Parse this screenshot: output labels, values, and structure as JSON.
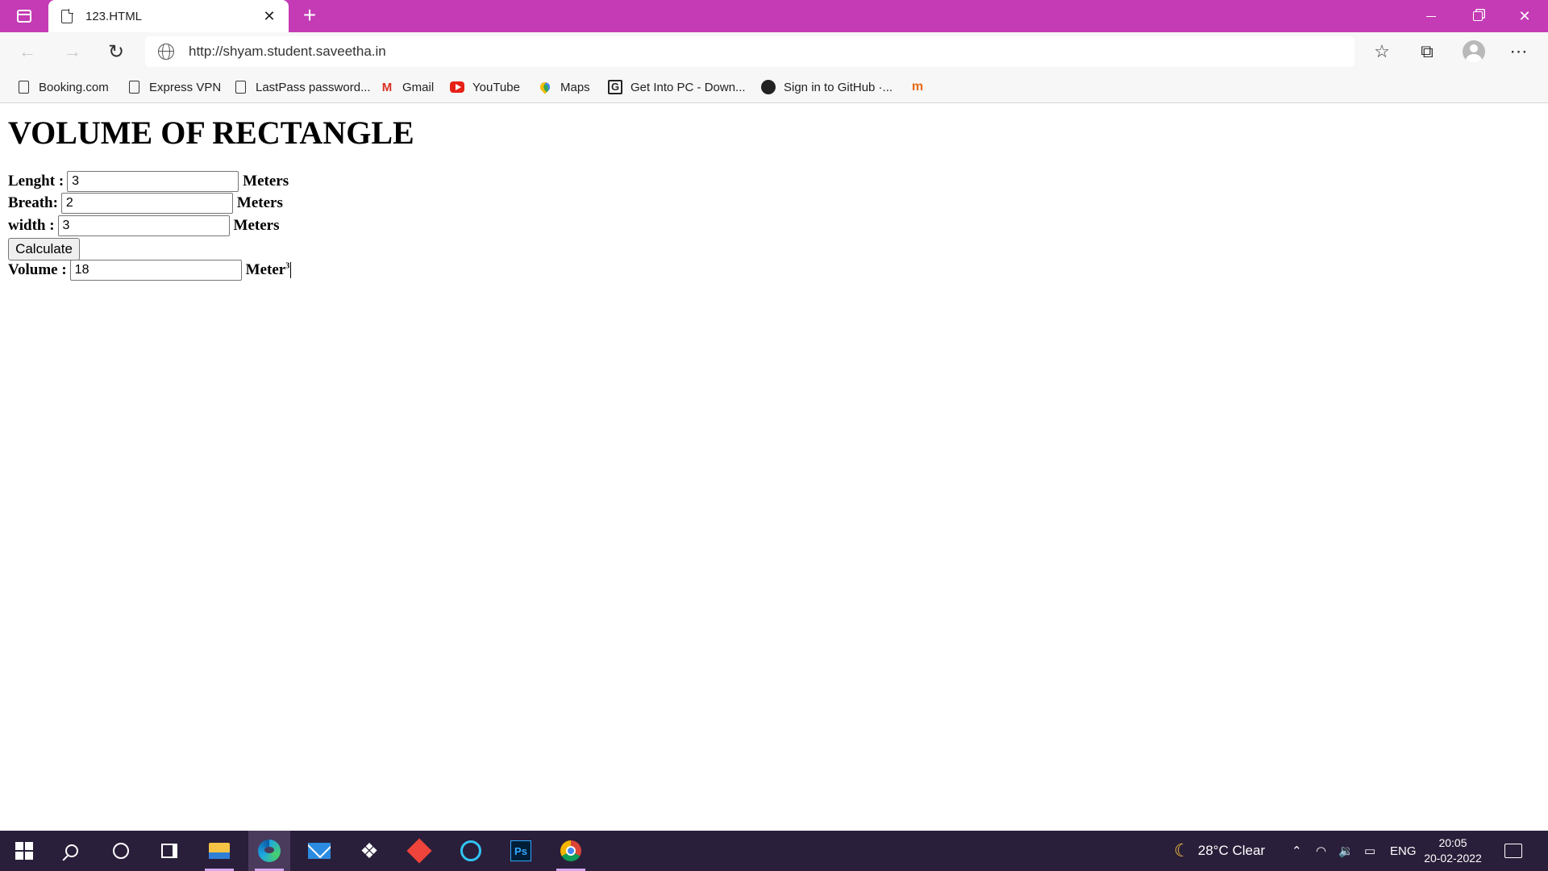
{
  "browser": {
    "tab_title": "123.HTML",
    "tab_close": "✕",
    "new_tab": "+",
    "url": "http://shyam.student.saveetha.in",
    "bookmarks": [
      {
        "label": "Booking.com",
        "icon": "page-icon"
      },
      {
        "label": "Express VPN",
        "icon": "page-icon"
      },
      {
        "label": "LastPass password...",
        "icon": "page-icon"
      },
      {
        "label": "Gmail",
        "icon": "gmail-icon"
      },
      {
        "label": "YouTube",
        "icon": "youtube-icon"
      },
      {
        "label": "Maps",
        "icon": "maps-icon"
      },
      {
        "label": "Get Into PC - Down...",
        "icon": "getintopc-icon"
      },
      {
        "label": "Sign in to GitHub ·...",
        "icon": "github-icon"
      }
    ],
    "last_bookmark_icon": "lastpass-logo-icon"
  },
  "page": {
    "title": "VOLUME OF RECTANGLE",
    "length_label": "Lenght :",
    "length_value": "3",
    "breadth_label": "Breath:",
    "breadth_value": "2",
    "width_label": "width :",
    "width_value": "3",
    "unit": "Meters",
    "calculate_label": "Calculate",
    "volume_label": "Volume :",
    "volume_value": "18",
    "volume_unit": "Meter",
    "volume_unit_power": "3"
  },
  "taskbar": {
    "apps": [
      "start",
      "search",
      "cortana",
      "task-view",
      "file-explorer",
      "edge",
      "mail",
      "dropbox",
      "anydesk",
      "alexa",
      "photoshop",
      "chrome"
    ],
    "weather": "28°C  Clear",
    "language": "ENG",
    "time": "20:05",
    "date": "20-02-2022"
  },
  "colors": {
    "titlebar": "#c43bb5",
    "taskbar": "#2a1f3a"
  }
}
